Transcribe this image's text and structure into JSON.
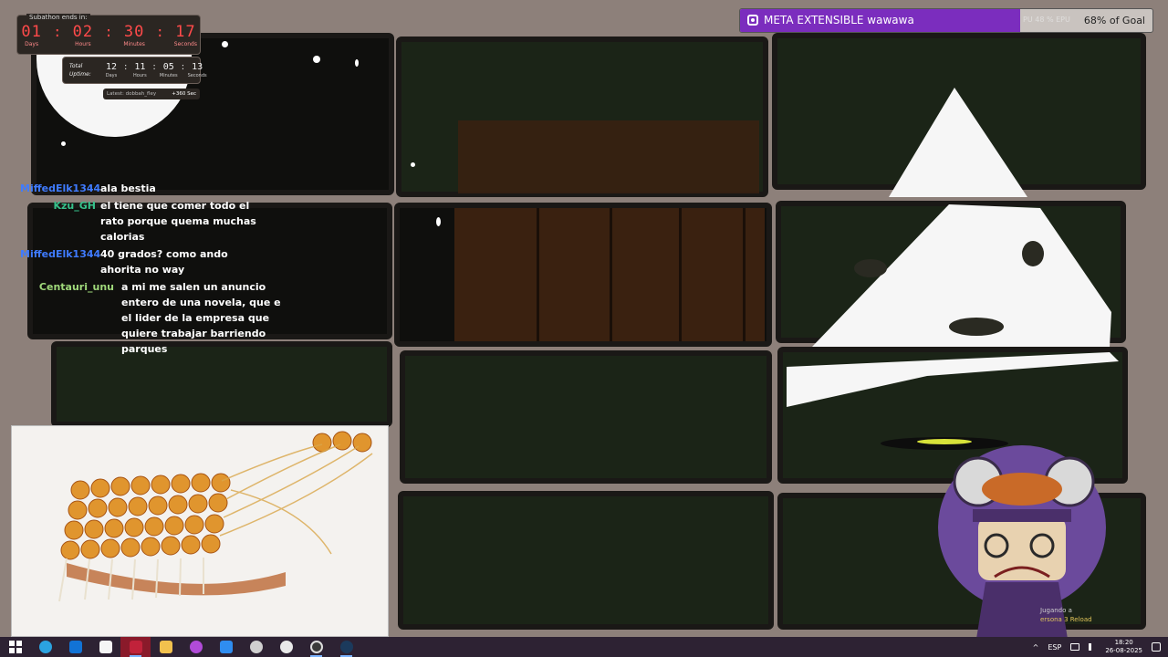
{
  "timer": {
    "caption": "Subathon ends in:",
    "days": "01",
    "hours": "02",
    "minutes": "30",
    "seconds": "17",
    "days_label": "Days",
    "hours_label": "Hours",
    "minutes_label": "Minutes",
    "seconds_label": "Seconds"
  },
  "uptime": {
    "label": "Total Uptime:",
    "days": "12",
    "hours": "11",
    "minutes": "05",
    "seconds": "13",
    "days_label": "Days",
    "hours_label": "Hours",
    "minutes_label": "Minutes",
    "seconds_label": "Seconds"
  },
  "latest": {
    "text": "Latest: dobbah_fley",
    "seconds": "+360 Sec"
  },
  "goal": {
    "title": "META EXTENSIBLE wawawa",
    "ghost_text": "PU 48 %   EPU",
    "percent_label": "68% of Goal",
    "progress": 0.68,
    "fill_color": "#7b2dbe",
    "icon": "heart-box-icon"
  },
  "chat": [
    {
      "user": "MiffedElk1344",
      "color": "#3f7bff",
      "text": "ala bestia"
    },
    {
      "user": "Kzu_GH",
      "color": "#35c08a",
      "text": "el tiene que comer todo el rato porque quema muchas calorias"
    },
    {
      "user": "MiffedElk1344",
      "color": "#3f7bff",
      "text": "40 grados? como ando ahorita no way"
    },
    {
      "user": "Centauri_unu",
      "color": "#9fd87a",
      "text": "a mi me salen un anuncio entero de una novela, que e el lider de la empresa que quiere trabajar barriendo parques"
    }
  ],
  "now_playing": {
    "line1": "Jugando a",
    "line2": "ersona 3 Reload"
  },
  "taskbar": {
    "icons": [
      "windows-start-icon",
      "edge-browser-icon",
      "outlook-icon",
      "store-icon",
      "red-app-icon",
      "file-explorer-icon",
      "chat-app-icon",
      "pen-app-icon",
      "swirl-app-icon",
      "chatgpt-icon",
      "obs-icon",
      "steam-icon"
    ],
    "language": "ESP",
    "time": "18:20",
    "date": "26-08-2025"
  }
}
